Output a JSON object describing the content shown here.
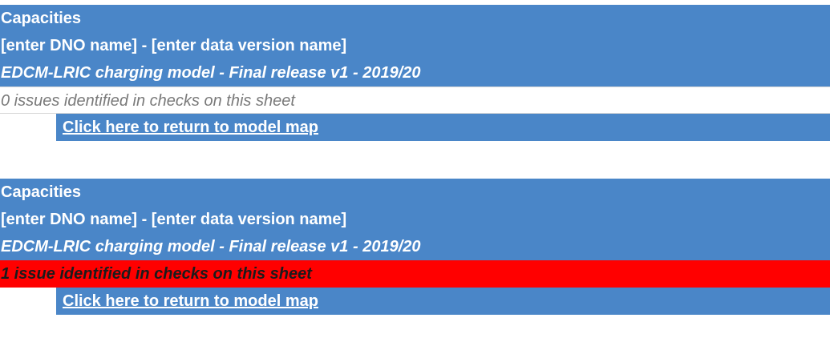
{
  "blocks": [
    {
      "sheet_title": "Capacities",
      "dno_line": "[enter DNO name] - [enter data version name]",
      "model_line": "EDCM-LRIC charging model - Final release v1 - 2019/20",
      "status_text": "0 issues identified in checks on this sheet",
      "status": "ok",
      "link_text": "Click here to return to model map"
    },
    {
      "sheet_title": "Capacities",
      "dno_line": "[enter DNO name] - [enter data version name]",
      "model_line": "EDCM-LRIC charging model - Final release v1 - 2019/20",
      "status_text": "1 issue identified in checks on this sheet",
      "status": "error",
      "link_text": "Click here to return to model map"
    }
  ],
  "colors": {
    "header_blue": "#4a86c8",
    "error_red": "#ff0000",
    "ok_grey_text": "#7a7a7a"
  }
}
